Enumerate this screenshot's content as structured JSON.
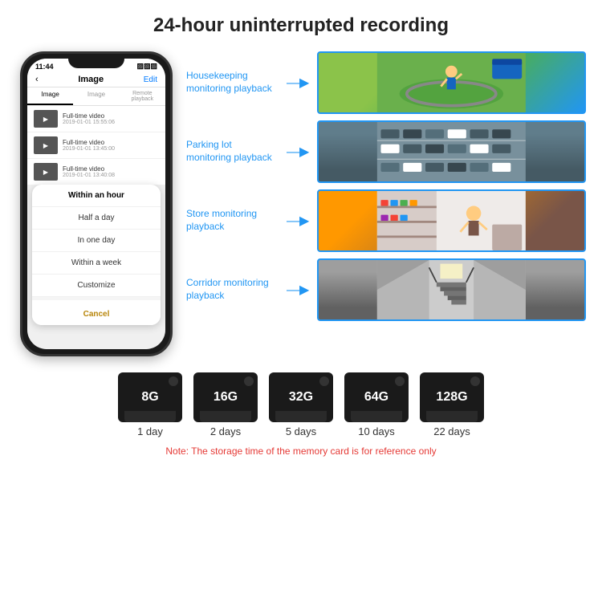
{
  "page": {
    "title": "24-hour uninterrupted recording",
    "monitoring_items": [
      {
        "id": "housekeeping",
        "label": "Housekeeping monitoring playback",
        "img_desc": "child playing on colorful mat"
      },
      {
        "id": "parking",
        "label": "Parking lot monitoring playback",
        "img_desc": "aerial view of parking lot with cars"
      },
      {
        "id": "store",
        "label": "Store monitoring playback",
        "img_desc": "store interior with person"
      },
      {
        "id": "corridor",
        "label": "Corridor monitoring playback",
        "img_desc": "corridor with stairs"
      }
    ],
    "phone": {
      "time": "11:44",
      "header_title": "Image",
      "header_edit": "Edit",
      "tabs": [
        "Image",
        "Image",
        "Remote playback"
      ],
      "list_items": [
        {
          "title": "Full-time video",
          "time": "2019-01-01 15:55:06"
        },
        {
          "title": "Full-time video",
          "time": "2019-01-01 13:45:00"
        },
        {
          "title": "Full-time video",
          "time": "2019-01-01 13:40:08"
        }
      ],
      "dropdown": {
        "items": [
          {
            "label": "Within an hour",
            "selected": true
          },
          {
            "label": "Half a day"
          },
          {
            "label": "In one day"
          },
          {
            "label": "Within a week"
          },
          {
            "label": "Customize"
          }
        ],
        "cancel_label": "Cancel"
      }
    },
    "storage_cards": [
      {
        "capacity": "8G",
        "days": "1 day"
      },
      {
        "capacity": "16G",
        "days": "2 days"
      },
      {
        "capacity": "32G",
        "days": "5 days"
      },
      {
        "capacity": "64G",
        "days": "10 days"
      },
      {
        "capacity": "128G",
        "days": "22 days"
      }
    ],
    "note": "Note: The storage time of the memory card is for reference only"
  }
}
